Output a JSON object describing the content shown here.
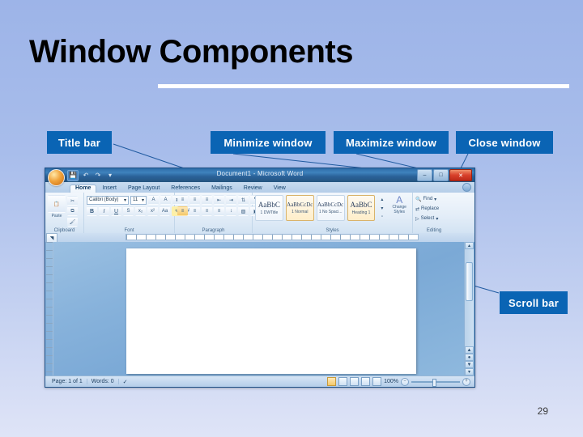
{
  "slide": {
    "title": "Window Components",
    "page_number": "29",
    "accent_color": "#0a64b4",
    "background_top": "#9db4e8",
    "background_bottom": "#dfe4f7"
  },
  "callouts": [
    {
      "id": "title-bar",
      "label": "Title bar"
    },
    {
      "id": "minimize-window",
      "label": "Minimize window"
    },
    {
      "id": "maximize-window",
      "label": "Maximize window"
    },
    {
      "id": "close-window",
      "label": "Close window"
    },
    {
      "id": "scroll-bar",
      "label": "Scroll bar"
    }
  ],
  "word_window": {
    "title": "Document1 - Microsoft Word",
    "controls": {
      "minimize": "–",
      "maximize": "□",
      "close": "✕"
    },
    "quick_access": [
      "save-icon",
      "undo-icon",
      "redo-icon",
      "customize-qat-icon"
    ],
    "tabs": [
      {
        "label": "Home",
        "active": true
      },
      {
        "label": "Insert",
        "active": false
      },
      {
        "label": "Page Layout",
        "active": false
      },
      {
        "label": "References",
        "active": false
      },
      {
        "label": "Mailings",
        "active": false
      },
      {
        "label": "Review",
        "active": false
      },
      {
        "label": "View",
        "active": false
      }
    ],
    "groups": [
      {
        "name": "Clipboard",
        "paste_label": "Paste"
      },
      {
        "name": "Font"
      },
      {
        "name": "Paragraph"
      },
      {
        "name": "Styles"
      },
      {
        "name": "Editing"
      }
    ],
    "font_group": {
      "font_name": "Calibri (Body)",
      "font_size": "11",
      "bold": "B",
      "italic": "I",
      "underline": "U",
      "grow_font": "A",
      "shrink_font": "A"
    },
    "styles": [
      {
        "sample": "AaBbC",
        "name": "1 DWTitle",
        "selected": false
      },
      {
        "sample": "AaBbCcDc",
        "name": "1 Normal",
        "selected": true
      },
      {
        "sample": "AaBbCcDc",
        "name": "1 No Spaci...",
        "selected": false
      },
      {
        "sample": "AaBbC",
        "name": "Heading 1",
        "selected": true
      }
    ],
    "change_styles_label": "Change Styles",
    "editing": [
      {
        "label": "Find",
        "icon": "binoculars-icon"
      },
      {
        "label": "Replace",
        "icon": "replace-icon"
      },
      {
        "label": "Select",
        "icon": "select-icon"
      }
    ],
    "status_bar": {
      "page": "Page: 1 of 1",
      "words": "Words: 0",
      "proofing": "proofing-icon",
      "zoom": "100%"
    }
  }
}
